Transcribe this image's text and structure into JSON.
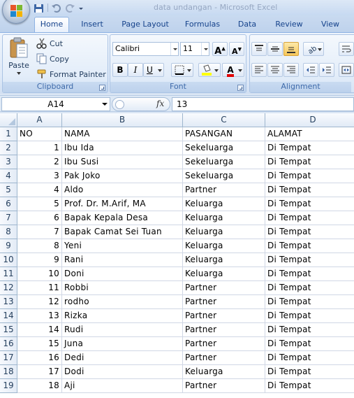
{
  "ribbon_tabs": [
    "Home",
    "Insert",
    "Page Layout",
    "Formulas",
    "Data",
    "Review",
    "View"
  ],
  "title": "data undangan - Microsoft Excel",
  "clipboard": {
    "paste_label": "Paste",
    "cut_label": "Cut",
    "copy_label": "Copy",
    "format_painter_label": "Format Painter",
    "group_label": "Clipboard"
  },
  "font": {
    "name": "Calibri",
    "size": "11",
    "group_label": "Font",
    "bold": "B",
    "italic": "I",
    "underline": "U"
  },
  "alignment": {
    "group_label": "Alignment"
  },
  "formula_bar": {
    "name_box": "A14",
    "fx": "fx",
    "content": "13"
  },
  "columns": [
    "A",
    "B",
    "C",
    "D"
  ],
  "rows": [
    {
      "n": "1",
      "a": "NO",
      "b": "NAMA",
      "c": "PASANGAN",
      "d": "ALAMAT"
    },
    {
      "n": "2",
      "a": "1",
      "b": "Ibu Ida",
      "c": "Sekeluarga",
      "d": "Di Tempat"
    },
    {
      "n": "3",
      "a": "2",
      "b": "Ibu Susi",
      "c": "Sekeluarga",
      "d": "Di Tempat"
    },
    {
      "n": "4",
      "a": "3",
      "b": "Pak Joko",
      "c": "Sekeluarga",
      "d": "Di Tempat"
    },
    {
      "n": "5",
      "a": "4",
      "b": "Aldo",
      "c": "Partner",
      "d": "Di Tempat"
    },
    {
      "n": "6",
      "a": "5",
      "b": "Prof. Dr. M.Arif, MA",
      "c": "Keluarga",
      "d": "Di Tempat"
    },
    {
      "n": "7",
      "a": "6",
      "b": "Bapak Kepala Desa",
      "c": "Keluarga",
      "d": "Di Tempat"
    },
    {
      "n": "8",
      "a": "7",
      "b": "Bapak Camat Sei Tuan",
      "c": "Keluarga",
      "d": "Di Tempat"
    },
    {
      "n": "9",
      "a": "8",
      "b": "Yeni",
      "c": "Keluarga",
      "d": "Di Tempat"
    },
    {
      "n": "10",
      "a": "9",
      "b": "Rani",
      "c": "Keluarga",
      "d": "Di Tempat"
    },
    {
      "n": "11",
      "a": "10",
      "b": "Doni",
      "c": "Keluarga",
      "d": "Di Tempat"
    },
    {
      "n": "12",
      "a": "11",
      "b": "Robbi",
      "c": "Partner",
      "d": "Di Tempat"
    },
    {
      "n": "13",
      "a": "12",
      "b": "rodho",
      "c": "Partner",
      "d": "Di Tempat"
    },
    {
      "n": "14",
      "a": "13",
      "b": "Rizka",
      "c": "Partner",
      "d": "Di Tempat"
    },
    {
      "n": "15",
      "a": "14",
      "b": "Rudi",
      "c": "Partner",
      "d": "Di Tempat"
    },
    {
      "n": "16",
      "a": "15",
      "b": "Juna",
      "c": "Partner",
      "d": "Di Tempat"
    },
    {
      "n": "17",
      "a": "16",
      "b": "Dedi",
      "c": "Partner",
      "d": "Di Tempat"
    },
    {
      "n": "18",
      "a": "17",
      "b": "Dodi",
      "c": "Keluarga",
      "d": "Di Tempat"
    },
    {
      "n": "19",
      "a": "18",
      "b": "Aji",
      "c": "Partner",
      "d": "Di Tempat"
    }
  ]
}
